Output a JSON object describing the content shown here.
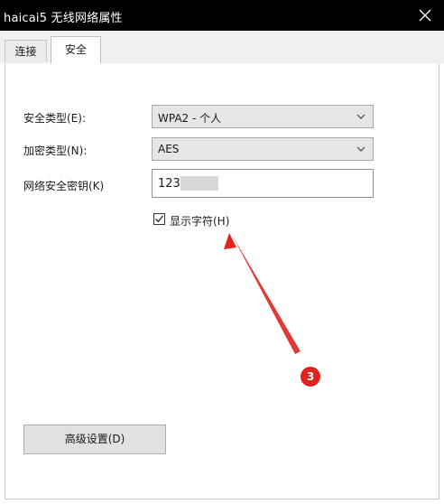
{
  "window": {
    "title": "haicai5 无线网络属性",
    "close_icon": "close-icon"
  },
  "tabs": [
    {
      "label": "连接",
      "active": false
    },
    {
      "label": "安全",
      "active": true
    }
  ],
  "form": {
    "security_type": {
      "label": "安全类型(E):",
      "value": "WPA2 - 个人"
    },
    "encryption_type": {
      "label": "加密类型(N):",
      "value": "AES"
    },
    "network_key": {
      "label": "网络安全密钥(K)",
      "value": "123"
    },
    "show_characters": {
      "label": "显示字符(H)",
      "checked": true
    }
  },
  "advanced_button": {
    "label": "高级设置(D)"
  },
  "annotation": {
    "badge": "3",
    "color": "#e0231f"
  }
}
